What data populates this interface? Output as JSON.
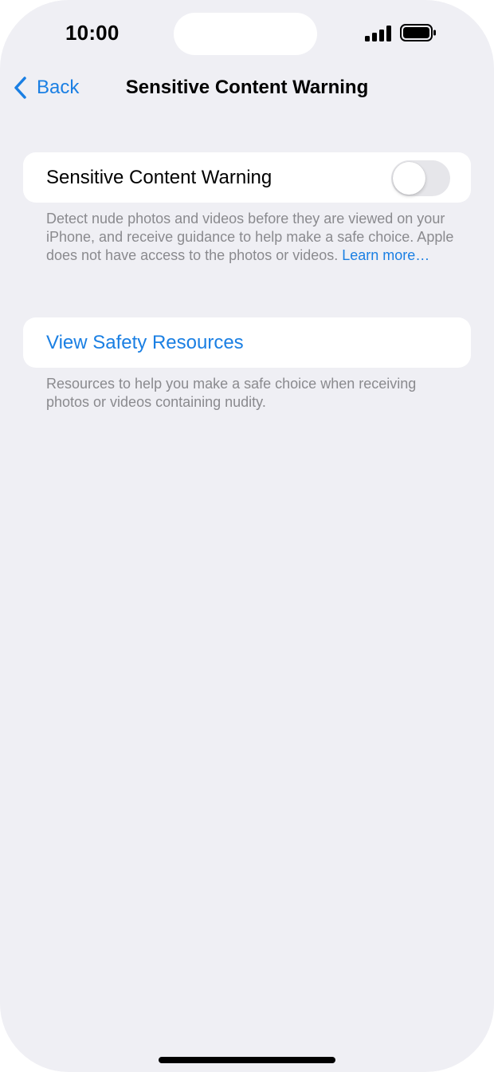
{
  "status_bar": {
    "time": "10:00",
    "signal_icon": "cellular-signal-icon",
    "battery_icon": "battery-icon"
  },
  "nav": {
    "back_label": "Back",
    "back_icon": "chevron-left-icon",
    "title": "Sensitive Content Warning"
  },
  "toggle_section": {
    "label": "Sensitive Content Warning",
    "toggle_on": false,
    "footnote": "Detect nude photos and videos before they are viewed on your iPhone, and receive guidance to help make a safe choice. Apple does not have access to the photos or videos.",
    "learn_more": "Learn more…"
  },
  "resources_section": {
    "link_label": "View Safety Resources",
    "footnote": "Resources to help you make a safe choice when receiving photos or videos containing nudity."
  },
  "colors": {
    "accent": "#1a7fe3",
    "background": "#efeff4",
    "secondary_text": "#8a8a8e",
    "toggle_off": "#e6e6ea"
  }
}
